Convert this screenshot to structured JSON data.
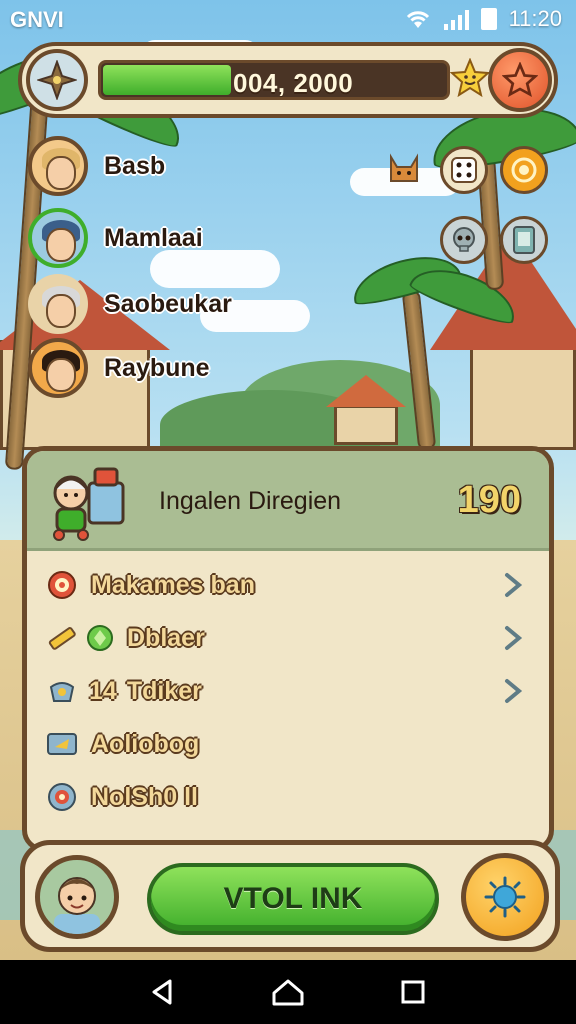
{
  "status_bar": {
    "carrier": "GNVI",
    "time": "11:20"
  },
  "hud": {
    "xp_text": "004, 2000",
    "xp_progress": 0.37,
    "icons": {
      "emblem": "compass-star-icon",
      "bonus": "smiling-star-icon",
      "favorite": "star-icon"
    }
  },
  "players": [
    {
      "name": "Basb",
      "hair_color": "#e0b66a",
      "ring_color": "#6b4a2b"
    },
    {
      "name": "Mamlaai",
      "hair_color": "#3b5f8a",
      "ring_color": "#3fae2b"
    },
    {
      "name": "Saobeukar",
      "hair_color": "#d8d8d8",
      "ring_color": "#6b4a2b"
    },
    {
      "name": "Raybune",
      "hair_color": "#2a1a10",
      "ring_color": "#6b4a2b"
    }
  ],
  "side_icons": [
    "cat-icon",
    "dice-icon",
    "target-icon",
    "skull-icon",
    "card-icon"
  ],
  "panel": {
    "header_title": "Ingalen Diregien",
    "header_count": "190",
    "items": [
      {
        "icon": "target-icon",
        "label": "Makames ban",
        "has_chevron": true
      },
      {
        "icon": "pencil-icon",
        "icon2": "gem-icon",
        "label": "Dblaer",
        "has_chevron": true
      },
      {
        "icon": "bag-icon",
        "prefix": "14",
        "label": "Tdiker",
        "has_chevron": true
      },
      {
        "icon": "tag-icon",
        "label": "Aoliobog",
        "has_chevron": false
      },
      {
        "icon": "ring-icon",
        "label": "NolSh0 ll",
        "has_chevron": false
      }
    ]
  },
  "bottom": {
    "play_label": "VTOL INK",
    "icons": {
      "profile": "avatar-icon",
      "settings": "sun-bug-icon"
    }
  },
  "nav": {
    "icons": [
      "back-icon",
      "home-icon",
      "recents-icon"
    ]
  },
  "colors": {
    "wood": "#6b4a2b",
    "parchment": "#f1e6c8",
    "green": "#3fae2b",
    "header_green": "#aabd93"
  }
}
